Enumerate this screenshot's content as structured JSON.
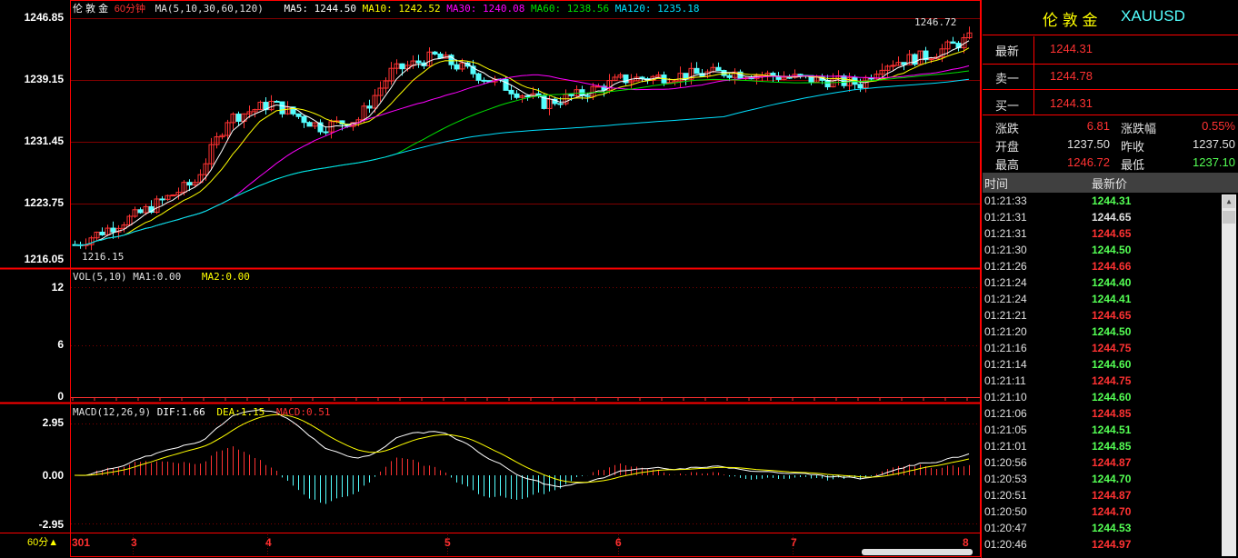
{
  "price_panel": {
    "instrument": "伦 敦 金",
    "period": "60分钟",
    "ma_params": "MA(5,10,30,60,120)",
    "ma5": "MA5: 1244.50",
    "ma10": "MA10: 1242.52",
    "ma30": "MA30: 1240.08",
    "ma60": "MA60: 1238.56",
    "ma120": "MA120: 1235.18",
    "y_labels": [
      "1246.85",
      "1239.15",
      "1231.45",
      "1223.75",
      "1216.05"
    ],
    "high_mark": "1246.72",
    "low_mark": "1216.15"
  },
  "volume_panel": {
    "params": "VOL(5,10)",
    "ma1": "MA1:0.00",
    "ma2": "MA2:0.00",
    "y_labels": [
      "12",
      "6",
      "0"
    ]
  },
  "macd_panel": {
    "params": "MACD(12,26,9)",
    "dif": "DIF:1.66",
    "dea": "DEA:1.15",
    "macd": "MACD:0.51",
    "y_labels": [
      "2.95",
      "0.00",
      "-2.95"
    ]
  },
  "x_axis": {
    "period_label": "60分",
    "labels": [
      "301",
      "3",
      "4",
      "5",
      "6",
      "7",
      "8"
    ]
  },
  "colors": {
    "up": "#ff3232",
    "down": "#54ffff",
    "ma5": "#ffffff",
    "ma10": "#ffff00",
    "ma30": "#ff00ff",
    "ma60": "#00e000",
    "ma120": "#00e0ff",
    "grid": "#800000",
    "frame": "#ff0000"
  },
  "quote": {
    "name": "伦 敦 金",
    "symbol": "XAUUSD",
    "latest_label": "最新",
    "latest": "1244.31",
    "ask_label": "卖一",
    "ask": "1244.78",
    "bid_label": "买一",
    "bid": "1244.31",
    "change_label": "涨跌",
    "change": "6.81",
    "change_pct_label": "涨跌幅",
    "change_pct": "0.55%",
    "open_label": "开盘",
    "open": "1237.50",
    "prev_close_label": "昨收",
    "prev_close": "1237.50",
    "high_label": "最高",
    "high": "1246.72",
    "low_label": "最低",
    "low": "1237.10"
  },
  "ticks": {
    "time_header": "时间",
    "price_header": "最新价",
    "rows": [
      {
        "time": "01:21:33",
        "price": "1244.31",
        "dir": "down"
      },
      {
        "time": "01:21:31",
        "price": "1244.65",
        "dir": "flat"
      },
      {
        "time": "01:21:31",
        "price": "1244.65",
        "dir": "up"
      },
      {
        "time": "01:21:30",
        "price": "1244.50",
        "dir": "down"
      },
      {
        "time": "01:21:26",
        "price": "1244.66",
        "dir": "up"
      },
      {
        "time": "01:21:24",
        "price": "1244.40",
        "dir": "down"
      },
      {
        "time": "01:21:24",
        "price": "1244.41",
        "dir": "down"
      },
      {
        "time": "01:21:21",
        "price": "1244.65",
        "dir": "up"
      },
      {
        "time": "01:21:20",
        "price": "1244.50",
        "dir": "down"
      },
      {
        "time": "01:21:16",
        "price": "1244.75",
        "dir": "up"
      },
      {
        "time": "01:21:14",
        "price": "1244.60",
        "dir": "down"
      },
      {
        "time": "01:21:11",
        "price": "1244.75",
        "dir": "up"
      },
      {
        "time": "01:21:10",
        "price": "1244.60",
        "dir": "down"
      },
      {
        "time": "01:21:06",
        "price": "1244.85",
        "dir": "up"
      },
      {
        "time": "01:21:05",
        "price": "1244.51",
        "dir": "down"
      },
      {
        "time": "01:21:01",
        "price": "1244.85",
        "dir": "down"
      },
      {
        "time": "01:20:56",
        "price": "1244.87",
        "dir": "up"
      },
      {
        "time": "01:20:53",
        "price": "1244.70",
        "dir": "down"
      },
      {
        "time": "01:20:51",
        "price": "1244.87",
        "dir": "up"
      },
      {
        "time": "01:20:50",
        "price": "1244.70",
        "dir": "up"
      },
      {
        "time": "01:20:47",
        "price": "1244.53",
        "dir": "down"
      },
      {
        "time": "01:20:46",
        "price": "1244.97",
        "dir": "up"
      }
    ]
  }
}
